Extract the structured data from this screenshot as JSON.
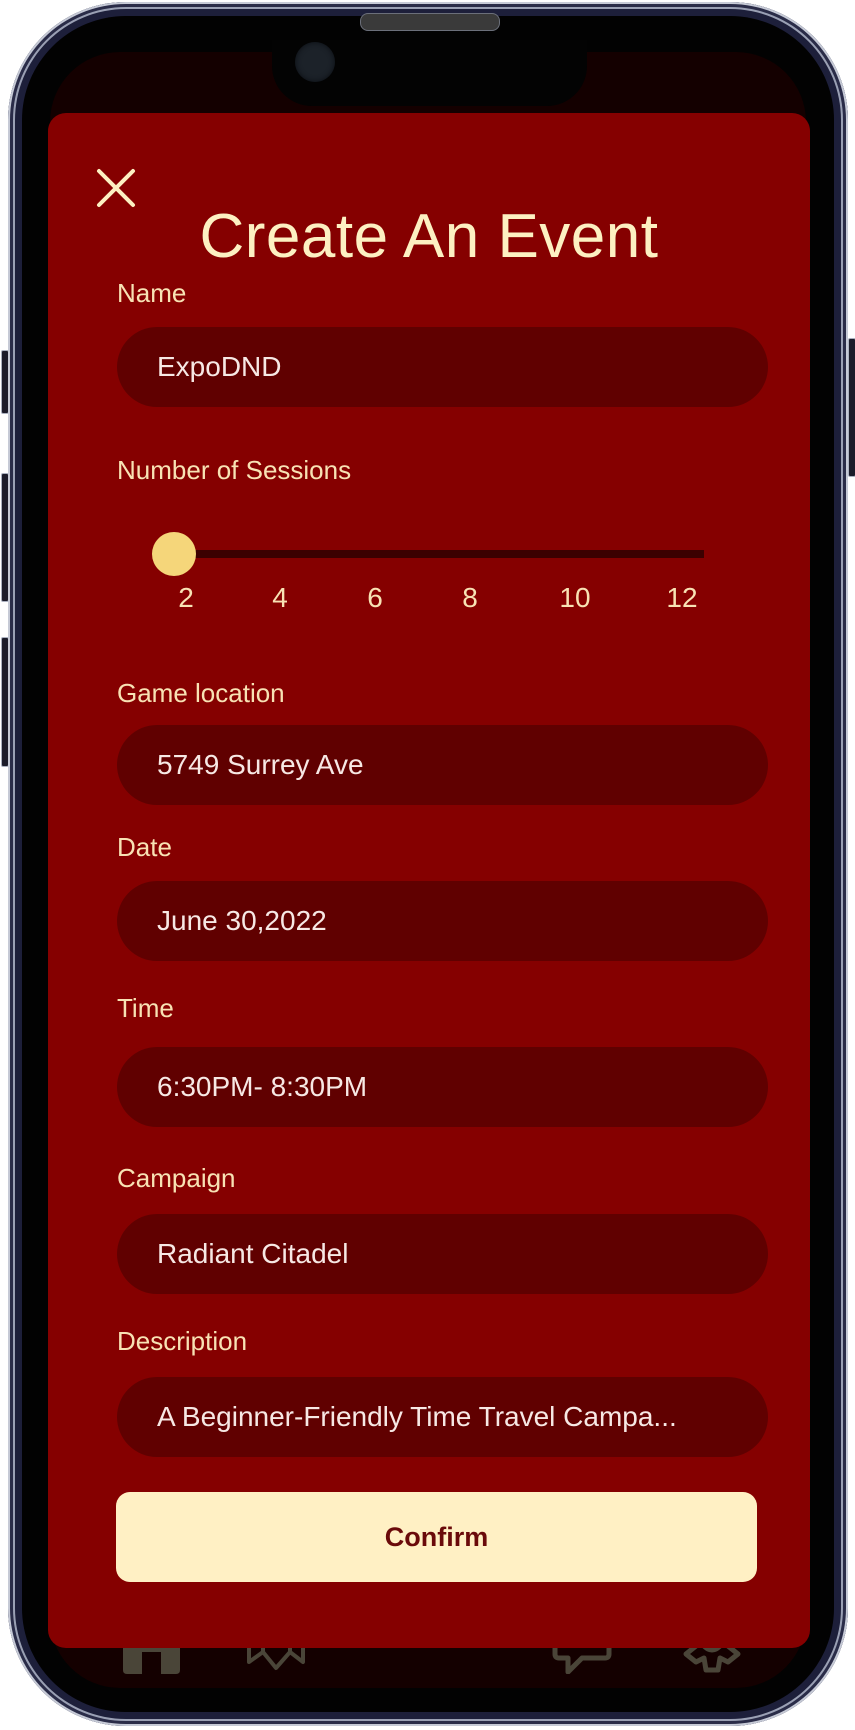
{
  "modal": {
    "title": "Create An Event",
    "close_icon": "close-icon",
    "fields": {
      "name": {
        "label": "Name",
        "value": "ExpoDND",
        "placeholder": ""
      },
      "location": {
        "label": "Game location",
        "value": "5749 Surrey Ave",
        "placeholder": ""
      },
      "date": {
        "label": "Date",
        "value": "June 30,2022",
        "placeholder": ""
      },
      "time": {
        "label": "Time",
        "value": "6:30PM- 8:30PM",
        "placeholder": ""
      },
      "campaign": {
        "label": "Campaign",
        "value": "Radiant Citadel",
        "placeholder": ""
      },
      "description": {
        "label": "Description",
        "value": "A Beginner-Friendly Time Travel Campa...",
        "placeholder": ""
      }
    },
    "sessions": {
      "label": "Number of Sessions",
      "value": 2,
      "min": 2,
      "max": 12,
      "ticks": [
        "2",
        "4",
        "6",
        "8",
        "10",
        "12"
      ]
    },
    "confirm_label": "Confirm"
  },
  "bottom_nav": {
    "items": [
      {
        "icon": "home-icon"
      },
      {
        "icon": "map-icon"
      },
      {
        "icon": "chat-icon"
      },
      {
        "icon": "gear-icon"
      }
    ]
  },
  "colors": {
    "modal_bg": "#850000",
    "field_bg": "#600000",
    "accent_cream": "#fdf0c2",
    "slider_thumb": "#f5d67a",
    "confirm_bg": "#fff0c4",
    "confirm_text": "#6a0a0a",
    "nav_bg": "#140000",
    "nav_icon": "#4a4538"
  }
}
